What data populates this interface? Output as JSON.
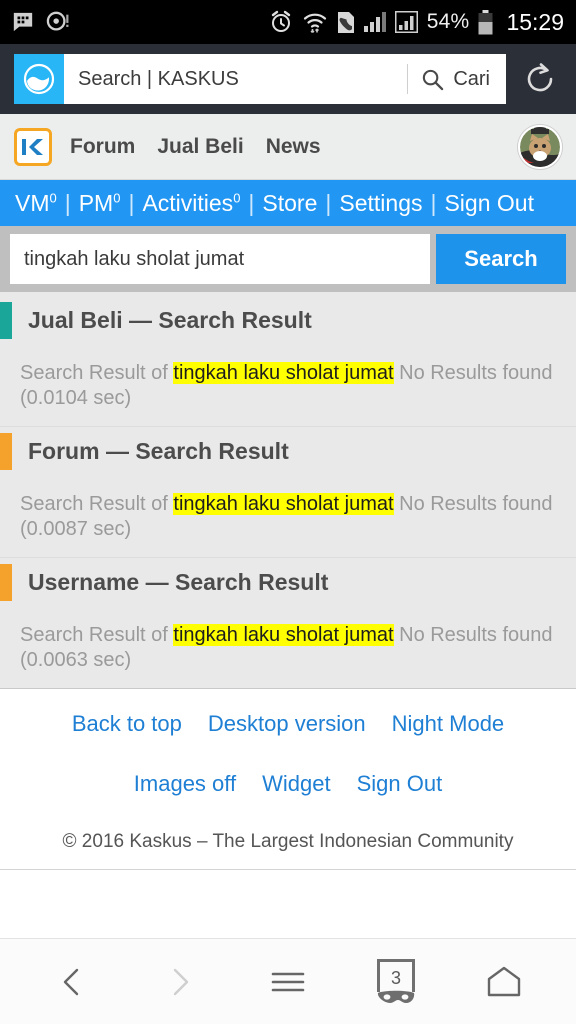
{
  "statusbar": {
    "left_icons": [
      "bbm-chat-icon",
      "disc-alert-icon"
    ],
    "right_icons": [
      "alarm-icon",
      "wifi-icon",
      "sim-card-icon",
      "signal-bars-icon",
      "signal-bars-boxed-icon"
    ],
    "battery_percent": "54%",
    "battery_icon": "battery-icon",
    "clock": "15:29"
  },
  "browser": {
    "app_icon": "uc-browser-icon",
    "page_title": "Search | KASKUS",
    "search_icon": "search-icon",
    "search_label": "Cari",
    "reload_icon": "reload-icon"
  },
  "site_header": {
    "logo": "kaskus-k-logo",
    "nav": [
      {
        "label": "Forum"
      },
      {
        "label": "Jual Beli"
      },
      {
        "label": "News"
      }
    ],
    "avatar": "user-avatar-cat"
  },
  "utility_nav": {
    "separator": "|",
    "items": [
      {
        "label": "VM",
        "count": "0"
      },
      {
        "label": "PM",
        "count": "0"
      },
      {
        "label": "Activities",
        "count": "0"
      },
      {
        "label": "Store",
        "count": ""
      },
      {
        "label": "Settings",
        "count": ""
      },
      {
        "label": "Sign Out",
        "count": ""
      }
    ]
  },
  "search": {
    "value": "tingkah laku sholat jumat",
    "placeholder": "tingkah laku sholat jumat",
    "button_label": "Search"
  },
  "results": {
    "prefix": "Search Result of ",
    "query": "tingkah laku sholat jumat",
    "suffix": " No Results found",
    "blocks": [
      {
        "title": "Jual Beli — Search Result",
        "accent_color": "#1aa79a",
        "time": "(0.0104 sec)"
      },
      {
        "title": "Forum — Search Result",
        "accent_color": "#f5a22d",
        "time": "(0.0087 sec)"
      },
      {
        "title": "Username — Search Result",
        "accent_color": "#f5a22d",
        "time": "(0.0063 sec)"
      }
    ]
  },
  "footer": {
    "row1": [
      {
        "label": "Back to top"
      },
      {
        "label": "Desktop version"
      },
      {
        "label": "Night Mode"
      }
    ],
    "row2": [
      {
        "label": "Images off"
      },
      {
        "label": "Widget"
      },
      {
        "label": "Sign Out"
      }
    ],
    "copyright": "© 2016 Kaskus – The Largest Indonesian Community",
    "link_color": "#1e7fd4"
  },
  "bottom_nav": {
    "items": [
      {
        "icon": "back-arrow-icon",
        "enabled": "true"
      },
      {
        "icon": "forward-arrow-icon",
        "enabled": "false"
      },
      {
        "icon": "menu-icon",
        "enabled": "true"
      },
      {
        "icon": "tabs-icon",
        "enabled": "true"
      },
      {
        "icon": "home-icon",
        "enabled": "true"
      }
    ],
    "tab_count": "3",
    "incognito_mask": "incognito-mask-icon"
  }
}
